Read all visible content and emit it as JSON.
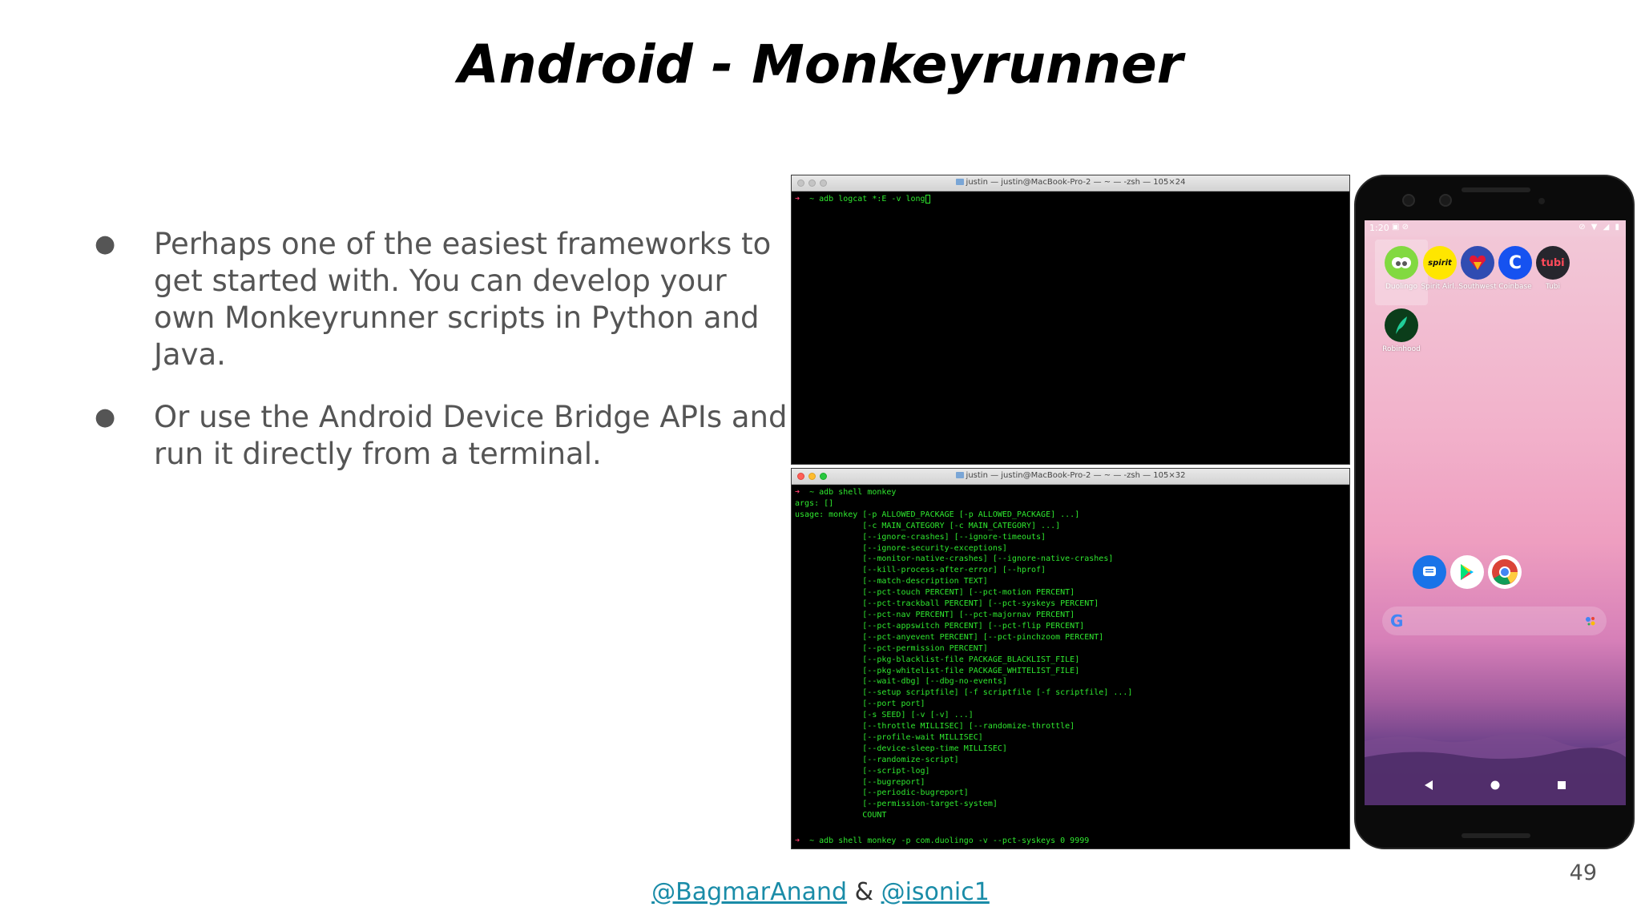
{
  "slide": {
    "title": "Android - Monkeyrunner",
    "bullets": [
      "Perhaps one of the easiest frameworks to get started with. You can develop your own Monkeyrunner scripts in Python and Java.",
      "Or use the Android Device Bridge APIs and run it directly from a terminal."
    ],
    "page_number": "49",
    "footer": {
      "handle1": "@BagmarAnand",
      "separator": "&",
      "handle2": "@isonic1"
    }
  },
  "terminal_top": {
    "title": "justin — justin@MacBook-Pro-2 — ~ — -zsh — 105×24",
    "lines": [
      "➜  ~ adb logcat *:E -v long"
    ]
  },
  "terminal_bottom": {
    "title": "justin — justin@MacBook-Pro-2 — ~ — -zsh — 105×32",
    "lines": [
      "➜  ~ adb shell monkey",
      "args: []",
      "usage: monkey [-p ALLOWED_PACKAGE [-p ALLOWED_PACKAGE] ...]",
      "              [-c MAIN_CATEGORY [-c MAIN_CATEGORY] ...]",
      "              [--ignore-crashes] [--ignore-timeouts]",
      "              [--ignore-security-exceptions]",
      "              [--monitor-native-crashes] [--ignore-native-crashes]",
      "              [--kill-process-after-error] [--hprof]",
      "              [--match-description TEXT]",
      "              [--pct-touch PERCENT] [--pct-motion PERCENT]",
      "              [--pct-trackball PERCENT] [--pct-syskeys PERCENT]",
      "              [--pct-nav PERCENT] [--pct-majornav PERCENT]",
      "              [--pct-appswitch PERCENT] [--pct-flip PERCENT]",
      "              [--pct-anyevent PERCENT] [--pct-pinchzoom PERCENT]",
      "              [--pct-permission PERCENT]",
      "              [--pkg-blacklist-file PACKAGE_BLACKLIST_FILE]",
      "              [--pkg-whitelist-file PACKAGE_WHITELIST_FILE]",
      "              [--wait-dbg] [--dbg-no-events]",
      "              [--setup scriptfile] [-f scriptfile [-f scriptfile] ...]",
      "              [--port port]",
      "              [-s SEED] [-v [-v] ...]",
      "              [--throttle MILLISEC] [--randomize-throttle]",
      "              [--profile-wait MILLISEC]",
      "              [--device-sleep-time MILLISEC]",
      "              [--randomize-script]",
      "              [--script-log]",
      "              [--bugreport]",
      "              [--periodic-bugreport]",
      "              [--permission-target-system]",
      "              COUNT"
    ],
    "last_command": "➜  ~ adb shell monkey -p com.duolingo -v --pct-syskeys 0 9999"
  },
  "phone": {
    "time": "1:20",
    "apps_row1": [
      {
        "label": "Duolingo",
        "color": "#58cc02",
        "icon": "duolingo-icon"
      },
      {
        "label": "Spirit Airl..",
        "color": "#ffe600",
        "icon": "spirit-icon",
        "text": "spirit"
      },
      {
        "label": "Southwest",
        "color": "#304cb2",
        "icon": "southwest-icon"
      },
      {
        "label": "Coinbase",
        "color": "#1652f0",
        "icon": "coinbase-icon",
        "text": "C"
      },
      {
        "label": "Tubi",
        "color": "#26262d",
        "icon": "tubi-icon",
        "text": "tubi"
      }
    ],
    "apps_row2": [
      {
        "label": "Robinhood",
        "color": "#0b3d1a",
        "icon": "robinhood-icon"
      }
    ],
    "dock": [
      {
        "icon": "messages-icon",
        "color": "#1a73e8"
      },
      {
        "icon": "play-store-icon",
        "color": "#ffffff"
      },
      {
        "icon": "chrome-icon",
        "color": "#ffffff"
      }
    ],
    "search_g": "G"
  }
}
